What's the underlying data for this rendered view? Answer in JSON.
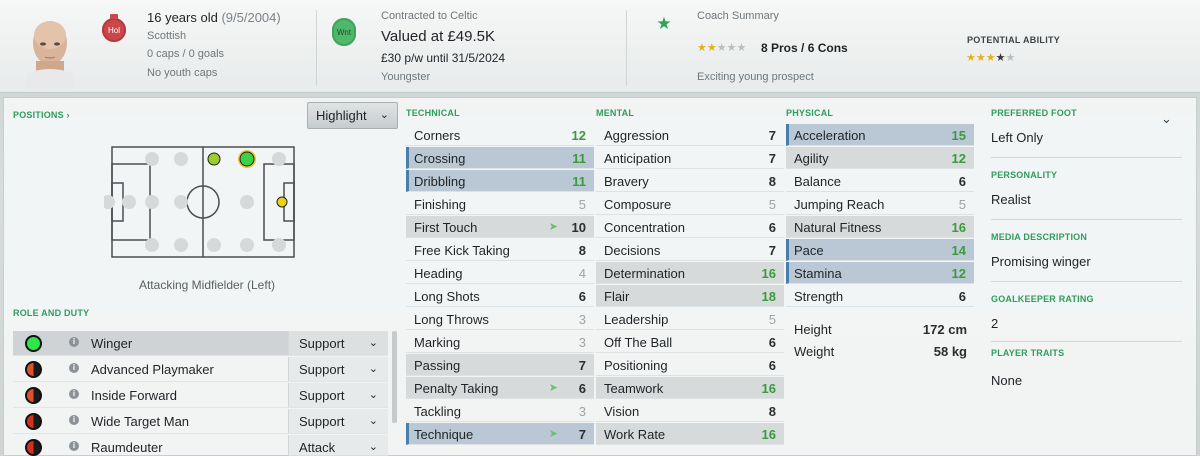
{
  "header": {
    "club_badge_text": "Hol",
    "age_text": "16 years old",
    "dob_text": "(9/5/2004)",
    "nationality": "Scottish",
    "caps": "0 caps / 0 goals",
    "youth_caps": "No youth caps",
    "contract_badge_text": "Wnt",
    "contract": "Contracted to Celtic",
    "value": "Valued at £49.5K",
    "wage": "£30 p/w until 31/5/2024",
    "status": "Youngster",
    "coach_summary_label": "Coach Summary",
    "coach_stars": 1.5,
    "pros_cons": "8 Pros / 6 Cons",
    "prospect": "Exciting young prospect",
    "potential_label": "POTENTIAL ABILITY",
    "potential_stars": 3.5
  },
  "positions": {
    "label": "POSITIONS",
    "highlight_button": "Highlight",
    "caption": "Attacking Midfielder (Left)"
  },
  "roles": {
    "label": "ROLE AND DUTY",
    "items": [
      {
        "name": "Winger",
        "duty": "Support",
        "color": "#2ee64a"
      },
      {
        "name": "Advanced Playmaker",
        "duty": "Support",
        "color": "#d9542e"
      },
      {
        "name": "Inside Forward",
        "duty": "Support",
        "color": "#d9542e"
      },
      {
        "name": "Wide Target Man",
        "duty": "Support",
        "color": "#d0321f"
      },
      {
        "name": "Raumdeuter",
        "duty": "Attack",
        "color": "#d0321f"
      }
    ]
  },
  "technical": {
    "label": "TECHNICAL",
    "rows": [
      {
        "name": "Corners",
        "value": "12"
      },
      {
        "name": "Crossing",
        "value": "11"
      },
      {
        "name": "Dribbling",
        "value": "11"
      },
      {
        "name": "Finishing",
        "value": "5"
      },
      {
        "name": "First Touch",
        "value": "10"
      },
      {
        "name": "Free Kick Taking",
        "value": "8"
      },
      {
        "name": "Heading",
        "value": "4"
      },
      {
        "name": "Long Shots",
        "value": "6"
      },
      {
        "name": "Long Throws",
        "value": "3"
      },
      {
        "name": "Marking",
        "value": "3"
      },
      {
        "name": "Passing",
        "value": "7"
      },
      {
        "name": "Penalty Taking",
        "value": "6"
      },
      {
        "name": "Tackling",
        "value": "3"
      },
      {
        "name": "Technique",
        "value": "7"
      }
    ]
  },
  "mental": {
    "label": "MENTAL",
    "rows": [
      {
        "name": "Aggression",
        "value": "7"
      },
      {
        "name": "Anticipation",
        "value": "7"
      },
      {
        "name": "Bravery",
        "value": "8"
      },
      {
        "name": "Composure",
        "value": "5"
      },
      {
        "name": "Concentration",
        "value": "6"
      },
      {
        "name": "Decisions",
        "value": "7"
      },
      {
        "name": "Determination",
        "value": "16"
      },
      {
        "name": "Flair",
        "value": "18"
      },
      {
        "name": "Leadership",
        "value": "5"
      },
      {
        "name": "Off The Ball",
        "value": "6"
      },
      {
        "name": "Positioning",
        "value": "6"
      },
      {
        "name": "Teamwork",
        "value": "16"
      },
      {
        "name": "Vision",
        "value": "8"
      },
      {
        "name": "Work Rate",
        "value": "16"
      }
    ]
  },
  "physical": {
    "label": "PHYSICAL",
    "rows": [
      {
        "name": "Acceleration",
        "value": "15"
      },
      {
        "name": "Agility",
        "value": "12"
      },
      {
        "name": "Balance",
        "value": "6"
      },
      {
        "name": "Jumping Reach",
        "value": "5"
      },
      {
        "name": "Natural Fitness",
        "value": "16"
      },
      {
        "name": "Pace",
        "value": "14"
      },
      {
        "name": "Stamina",
        "value": "12"
      },
      {
        "name": "Strength",
        "value": "6"
      }
    ],
    "height_label": "Height",
    "height": "172 cm",
    "weight_label": "Weight",
    "weight": "58 kg"
  },
  "info": {
    "preferred_foot_label": "PREFERRED FOOT",
    "preferred_foot": "Left Only",
    "personality_label": "PERSONALITY",
    "personality": "Realist",
    "media_label": "MEDIA DESCRIPTION",
    "media": "Promising winger",
    "gk_label": "GOALKEEPER RATING",
    "gk": "2",
    "traits_label": "PLAYER TRAITS",
    "traits": "None"
  }
}
